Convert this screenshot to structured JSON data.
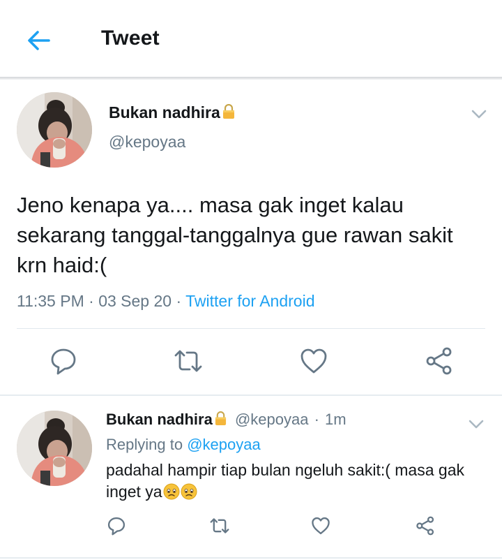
{
  "header": {
    "title": "Tweet"
  },
  "main_tweet": {
    "display_name": "Bukan nadhira",
    "handle": "@kepoyaa",
    "text": "Jeno kenapa ya.... masa gak inget kalau sekarang tanggal-tanggalnya gue rawan sakit krn haid:(",
    "time": "11:35 PM",
    "date": "03 Sep 20",
    "source": "Twitter for Android",
    "dot": "·"
  },
  "reply": {
    "display_name": "Bukan nadhira",
    "handle": "@kepoyaa",
    "age": "1m",
    "dot": "·",
    "replying_label": "Replying to",
    "replying_to": "@kepoyaa",
    "text": "padahal hampir tiap bulan ngeluh sakit:( masa gak inget ya"
  },
  "icons": [
    "back-arrow-icon",
    "lock-icon",
    "chevron-down-icon",
    "reply-icon",
    "retweet-icon",
    "like-icon",
    "share-icon",
    "worried-face-emoji"
  ],
  "colors": {
    "accent": "#1da1f2",
    "muted": "#657786",
    "text": "#14171a",
    "icon": "#657786"
  }
}
